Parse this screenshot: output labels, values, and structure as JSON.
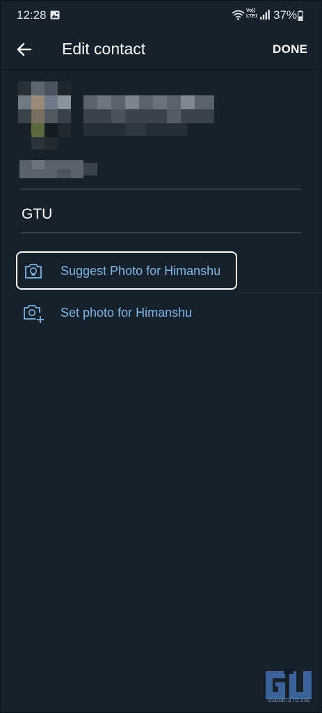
{
  "status_bar": {
    "time": "12:28",
    "network_label_top": "Vo))",
    "network_label_bottom": "LTE1",
    "battery_percent": "37%",
    "icons": [
      "gallery-icon",
      "wifi-icon",
      "signal-icon",
      "battery-icon"
    ]
  },
  "header": {
    "title": "Edit contact",
    "done_label": "DONE",
    "back_icon": "back-arrow-icon"
  },
  "contact": {
    "organization": "GTU"
  },
  "actions": {
    "suggest_photo_label": "Suggest Photo for Himanshu",
    "suggest_photo_icon": "camera-bulb-icon",
    "set_photo_label": "Set photo for Himanshu",
    "set_photo_icon": "camera-add-icon"
  },
  "colors": {
    "background": "#17212b",
    "accent_link": "#7fb6e6",
    "text": "#ffffff",
    "divider": "#5e6b77"
  },
  "watermark": {
    "text": "GADGETS TO USE"
  }
}
